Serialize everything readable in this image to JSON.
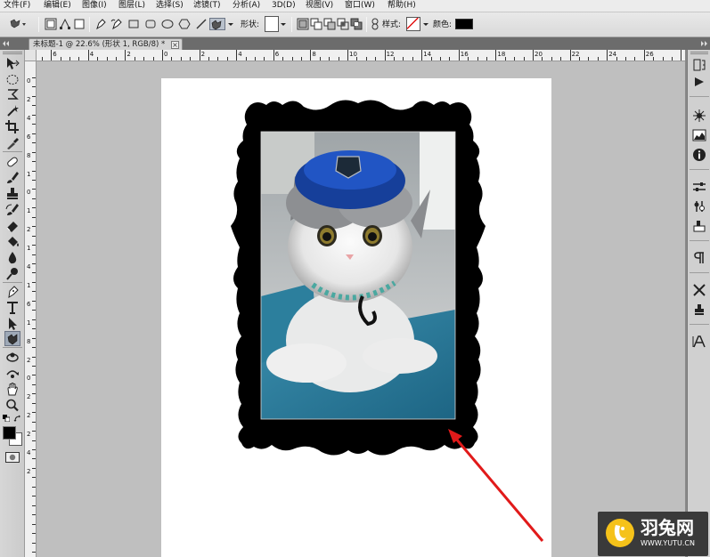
{
  "menubar": {
    "items": [
      {
        "label": "文件(F)"
      },
      {
        "label": "编辑(E)"
      },
      {
        "label": "图像(I)"
      },
      {
        "label": "图层(L)"
      },
      {
        "label": "选择(S)"
      },
      {
        "label": "滤镜(T)"
      },
      {
        "label": "分析(A)"
      },
      {
        "label": "3D(D)"
      },
      {
        "label": "视图(V)"
      },
      {
        "label": "窗口(W)"
      },
      {
        "label": "帮助(H)"
      }
    ]
  },
  "options_bar": {
    "shape_label": "形状:",
    "style_label": "样式:",
    "color_label": "颜色:",
    "color_value": "#000000"
  },
  "document": {
    "tab_title": "未标题-1 @ 22.6% (形状 1, RGB/8) *",
    "close_glyph": "×"
  },
  "rulers": {
    "top_labels": [
      "6",
      "4",
      "2",
      "0",
      "2",
      "4",
      "6",
      "8",
      "10",
      "12",
      "14",
      "16",
      "18",
      "20",
      "22",
      "24",
      "26"
    ],
    "left_labels": [
      "0",
      "2",
      "4",
      "6",
      "8",
      "1",
      "0",
      "1",
      "2",
      "1",
      "4",
      "1",
      "6",
      "1",
      "8",
      "2",
      "0",
      "2",
      "2",
      "2",
      "4",
      "2"
    ]
  },
  "colors": {
    "foreground": "#000000",
    "background": "#ffffff",
    "arrow": "#e11a1a",
    "frame": "#000000"
  },
  "watermark": {
    "name": "羽兔网",
    "url": "WWW.YUTU.CN"
  },
  "icons": {
    "toolbox": [
      "move-icon",
      "marquee-icon",
      "lasso-icon",
      "magic-wand-icon",
      "crop-icon",
      "eyedropper-icon",
      "healing-brush-icon",
      "brush-icon",
      "stamp-icon",
      "history-brush-icon",
      "eraser-icon",
      "paint-bucket-icon",
      "blur-icon",
      "dodge-icon",
      "pen-icon",
      "type-icon",
      "path-select-icon",
      "custom-shape-icon",
      "3d-rotate-icon",
      "3d-orbit-icon",
      "hand-icon",
      "zoom-icon"
    ],
    "dock": [
      "history-icon",
      "navigator-icon",
      "histogram-icon",
      "info-icon",
      "adjustments-icon",
      "masks-icon",
      "styles-icon",
      "paragraph-icon",
      "tools-preset-icon",
      "clone-source-icon",
      "character-icon"
    ]
  }
}
